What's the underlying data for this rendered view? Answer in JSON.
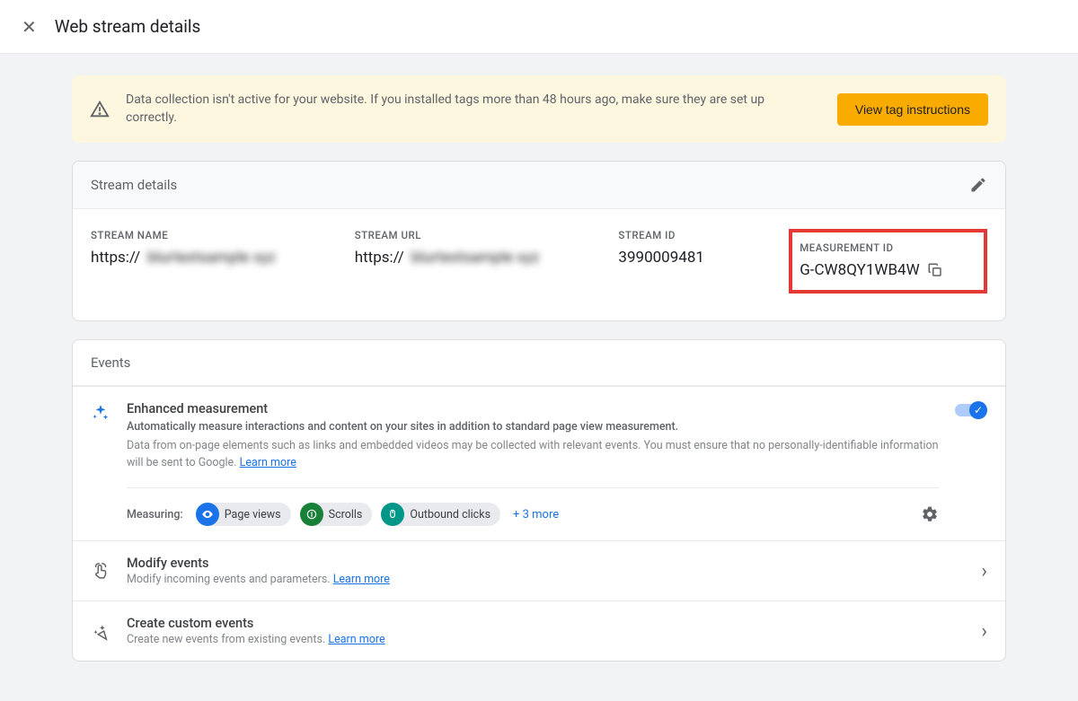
{
  "header": {
    "title": "Web stream details"
  },
  "banner": {
    "message": "Data collection isn't active for your website. If you installed tags more than 48 hours ago, make sure they are set up correctly.",
    "button_label": "View tag instructions"
  },
  "stream_details": {
    "section_title": "Stream details",
    "fields": {
      "name_label": "STREAM NAME",
      "name_prefix": "https://",
      "name_blur": "blurtextsample xyz",
      "url_label": "STREAM URL",
      "url_prefix": "https://",
      "url_blur": "blurtextsample xyz",
      "id_label": "STREAM ID",
      "id_value": "3990009481",
      "measurement_label": "MEASUREMENT ID",
      "measurement_value": "G-CW8QY1WB4W"
    }
  },
  "events": {
    "section_title": "Events",
    "enhanced": {
      "title": "Enhanced measurement",
      "subtitle": "Automatically measure interactions and content on your sites in addition to standard page view measurement.",
      "description": "Data from on-page elements such as links and embedded videos may be collected with relevant events. You must ensure that no personally-identifiable information will be sent to Google. ",
      "learn_more": "Learn more",
      "measuring_label": "Measuring:",
      "chips": {
        "page_views": "Page views",
        "scrolls": "Scrolls",
        "outbound": "Outbound clicks"
      },
      "more": "+ 3 more"
    },
    "modify": {
      "title": "Modify events",
      "subtitle": "Modify incoming events and parameters. ",
      "learn_more": "Learn more"
    },
    "create": {
      "title": "Create custom events",
      "subtitle": "Create new events from existing events. ",
      "learn_more": "Learn more"
    }
  }
}
